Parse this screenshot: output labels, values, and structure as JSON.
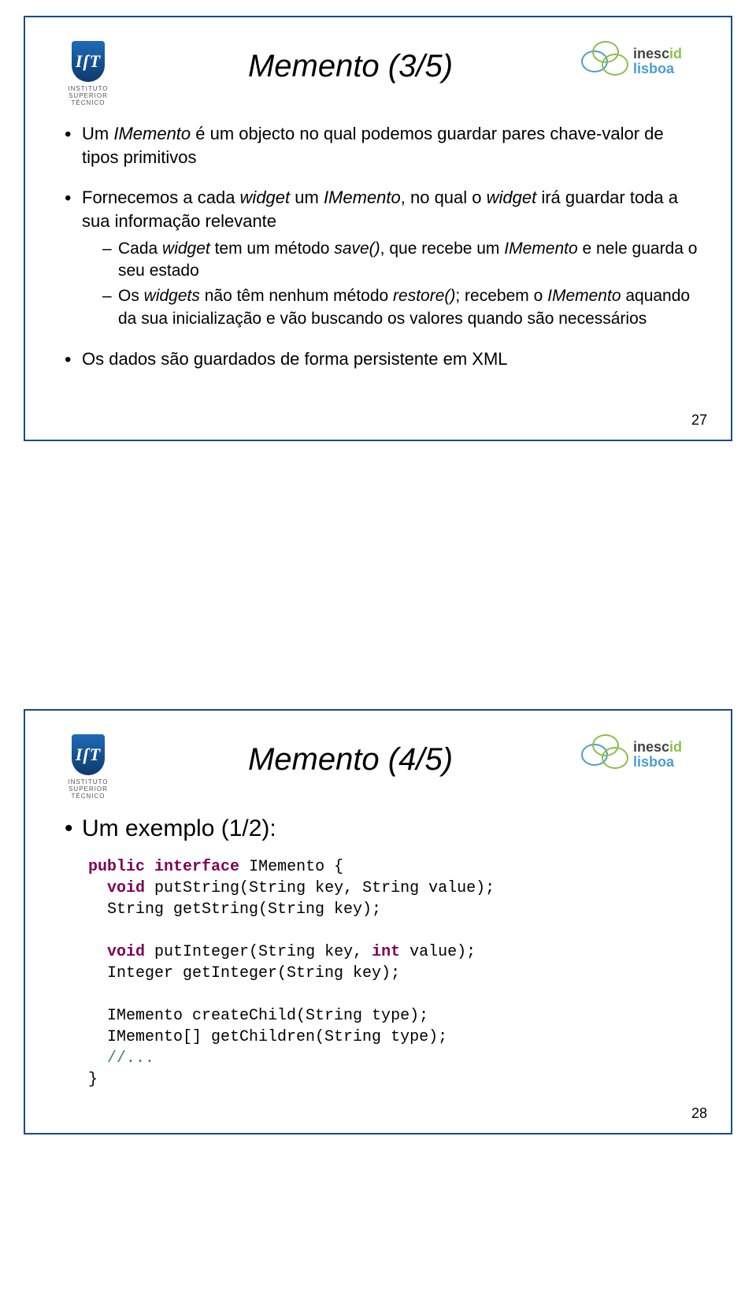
{
  "logoLeft": {
    "glyph": "IſT",
    "line1": "INSTITUTO",
    "line2": "SUPERIOR",
    "line3": "TÉCNICO"
  },
  "logoRight": {
    "top": "inesc",
    "id": "id",
    "bottom": "lisboa"
  },
  "slide1": {
    "title": "Memento (3/5)",
    "bullet1_a": "Um ",
    "bullet1_b": "IMemento",
    "bullet1_c": " é um objecto no qual podemos guardar pares chave-valor de tipos primitivos",
    "bullet2_a": "Fornecemos a cada ",
    "bullet2_b": "widget",
    "bullet2_c": " um ",
    "bullet2_d": "IMemento",
    "bullet2_e": ", no qual o ",
    "bullet2_f": "widget",
    "bullet2_g": " irá guardar toda a sua informação relevante",
    "sub1_a": "Cada ",
    "sub1_b": "widget",
    "sub1_c": " tem um método ",
    "sub1_d": "save()",
    "sub1_e": ", que recebe um ",
    "sub1_f": "IMemento",
    "sub1_g": " e nele guarda o seu estado",
    "sub2_a": "Os ",
    "sub2_b": "widgets",
    "sub2_c": " não têm nenhum método ",
    "sub2_d": "restore()",
    "sub2_e": "; recebem o ",
    "sub2_f": "IMemento",
    "sub2_g": " aquando da sua inicialização e vão buscando os valores quando são necessários",
    "bullet3": "Os dados são guardados de forma persistente em XML",
    "page": "27"
  },
  "slide2": {
    "title": "Memento (4/5)",
    "subtitle": "Um exemplo (1/2):",
    "code": {
      "l1_kw1": "public",
      "l1_sp1": " ",
      "l1_kw2": "interface",
      "l1_rest": " IMemento {",
      "l2_sp": "  ",
      "l2_kw": "void",
      "l2_rest": " putString(String key, String value);",
      "l3": "  String getString(String key);",
      "l4": "",
      "l5_sp": "  ",
      "l5_kw": "void",
      "l5_rest": " putInteger(String key, int value);",
      "l5_kw2": "int",
      "l6": "  Integer getInteger(String key);",
      "l7": "",
      "l8": "  IMemento createChild(String type);",
      "l9": "  IMemento[] getChildren(String type);",
      "l10_sp": "  ",
      "l10_cm": "//...",
      "l11": "}"
    },
    "page": "28"
  }
}
